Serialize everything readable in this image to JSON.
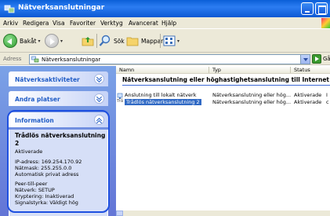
{
  "window": {
    "title": "Nätverksanslutningar"
  },
  "menu": {
    "items": [
      "Arkiv",
      "Redigera",
      "Visa",
      "Favoriter",
      "Verktyg",
      "Avancerat",
      "Hjälp"
    ]
  },
  "toolbar": {
    "back": "Bakåt",
    "search": "Sök",
    "folders": "Mappar"
  },
  "address": {
    "label": "Adress",
    "value": "Nätverksanslutningar",
    "go": "Gå"
  },
  "left_panel": {
    "network_tasks": "Nätverksaktiviteter",
    "other_places": "Andra platser",
    "info": "Information",
    "details": {
      "title_1": "Trådlös nätverksanslutning",
      "title_2": "2",
      "status": "Aktiverade",
      "ip": "IP-adress: 169.254.170.92",
      "mask": "Nätmask: 255.255.0.0",
      "auto": "Automatisk privat adress",
      "peer": "Peer-till-peer",
      "network": "Nätverk: SETUP",
      "encryption": "Kryptering: Inaktiverad",
      "signal": "Signalstyrka: Väldigt hög"
    }
  },
  "list": {
    "columns": {
      "name": "Namn",
      "type": "Typ",
      "status": "Status"
    },
    "group": "Nätverksanslutning eller höghastighetsanslutning till Internet",
    "rows": [
      {
        "name": "Anslutning till lokalt nätverk",
        "type": "Nätverksanslutning eller hög...",
        "status": "Aktiverade",
        "extra": "I"
      },
      {
        "prefix": "Trå",
        "name": "Trådlös nätverksanslutning 2",
        "type": "Nätverksanslutning eller hög...",
        "status": "Aktiverade",
        "extra": "c"
      }
    ]
  },
  "colors": {
    "title_bar": "#0a5fd8",
    "task_pane": "#6375d6",
    "selection": "#316ac5",
    "highlight_ring": "#1e50e0"
  }
}
